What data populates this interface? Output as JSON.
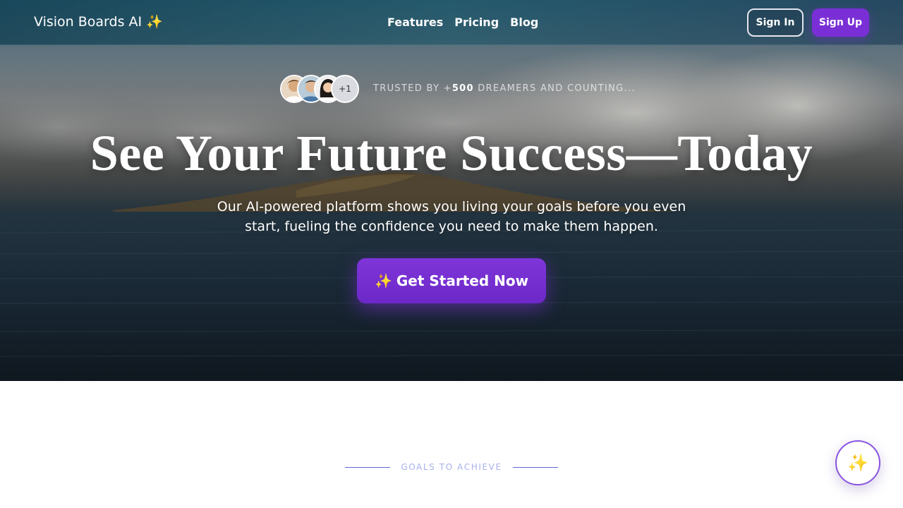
{
  "nav": {
    "brand": "Vision Boards AI ✨",
    "links": [
      "Features",
      "Pricing",
      "Blog"
    ],
    "sign_in": "Sign In",
    "sign_up": "Sign Up"
  },
  "hero": {
    "trust_prefix": "TRUSTED BY +",
    "trust_count": "500",
    "trust_suffix": " DREAMERS AND COUNTING...",
    "avatar_more": "+1",
    "headline": "See Your Future Success—Today",
    "subheadline": "Our AI-powered platform shows you living your goals before you even start, fueling the confidence you need to make them happen.",
    "cta_icon": "✨",
    "cta_label": "Get Started Now"
  },
  "section": {
    "eyebrow": "GOALS TO ACHIEVE"
  },
  "fab": {
    "icon": "✨"
  },
  "colors": {
    "accent": "#7a2fd6",
    "eyebrow_line": "#5b6ad8"
  }
}
